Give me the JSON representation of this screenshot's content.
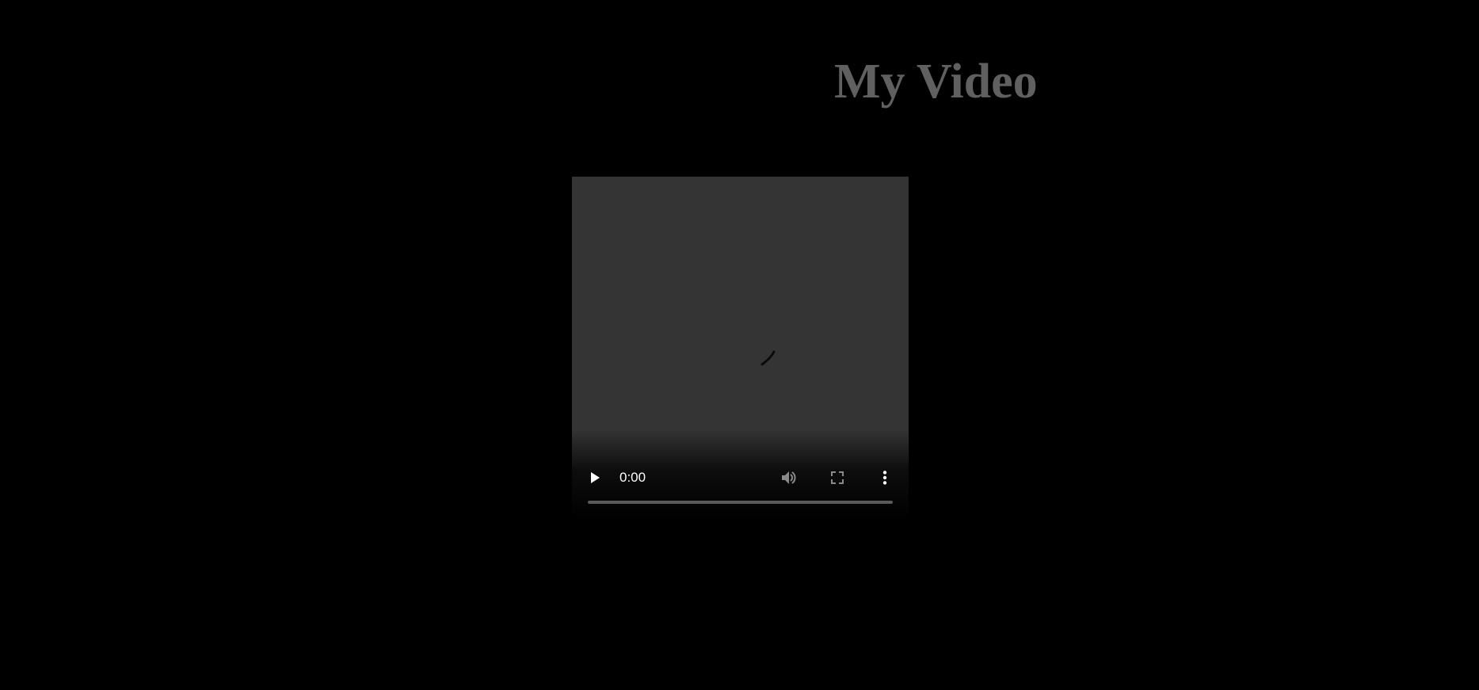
{
  "page": {
    "title": "My Video"
  },
  "video": {
    "current_time": "0:00",
    "progress_fraction": 0,
    "state": "loading",
    "icons": {
      "play": "play-icon",
      "mute": "volume-icon",
      "fullscreen": "fullscreen-icon",
      "more": "more-vert-icon",
      "spinner": "loading-spinner-icon"
    }
  },
  "colors": {
    "background": "#000000",
    "title": "#606060",
    "player_background": "#343434",
    "control_text": "#ffffff",
    "disabled_icon": "#8a8a8a",
    "timeline_track": "#5a5a5a"
  }
}
